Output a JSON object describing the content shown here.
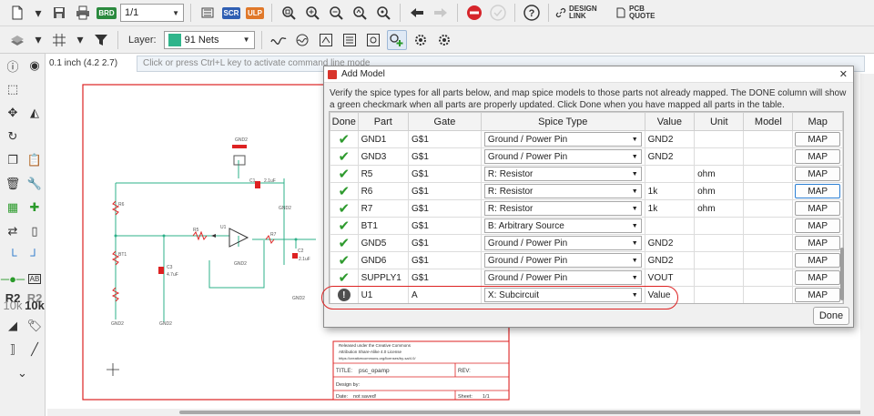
{
  "toolbar1": {
    "page_select": "1/1",
    "scr_label": "SCR",
    "ulp_label": "ULP",
    "design_link_label": "DESIGN LINK",
    "pcb_quote_label": "PCB QUOTE",
    "brd_label": "BRD"
  },
  "toolbar2": {
    "layer_label": "Layer:",
    "layer_value": "91 Nets",
    "layer_color": "#2fb58b"
  },
  "status": {
    "coordinate": "0.1 inch (4.2 2.7)",
    "command_placeholder": "Click or press Ctrl+L key to activate command line mode"
  },
  "left_toolbar": {
    "r2_label": "R2",
    "r2_sub": "10k",
    "r2b_label": "R2",
    "r2b_sub": "10k",
    "ab_label": "AB"
  },
  "dialog": {
    "title": "Add Model",
    "instructions": "Verify the spice types for all parts below, and map spice models to those parts not already mapped.  The DONE column will show a green checkmark when all parts are properly updated.  Click Done when you have mapped all parts in the table.",
    "columns": [
      "Done",
      "Part",
      "Gate",
      "Spice Type",
      "Value",
      "Unit",
      "Model",
      "Map"
    ],
    "rows": [
      {
        "done": "check",
        "part": "GND1",
        "gate": "G$1",
        "spice": "Ground / Power Pin",
        "value": "GND2",
        "unit": "",
        "model": "",
        "map": "MAP"
      },
      {
        "done": "check",
        "part": "GND3",
        "gate": "G$1",
        "spice": "Ground / Power Pin",
        "value": "GND2",
        "unit": "",
        "model": "",
        "map": "MAP"
      },
      {
        "done": "check",
        "part": "R5",
        "gate": "G$1",
        "spice": "R: Resistor",
        "value": "",
        "unit": "ohm",
        "model": "",
        "map": "MAP"
      },
      {
        "done": "check",
        "part": "R6",
        "gate": "G$1",
        "spice": "R: Resistor",
        "value": "1k",
        "unit": "ohm",
        "model": "",
        "map": "MAP"
      },
      {
        "done": "check",
        "part": "R7",
        "gate": "G$1",
        "spice": "R: Resistor",
        "value": "1k",
        "unit": "ohm",
        "model": "",
        "map": "MAP"
      },
      {
        "done": "check",
        "part": "BT1",
        "gate": "G$1",
        "spice": "B: Arbitrary Source",
        "value": "",
        "unit": "",
        "model": "",
        "map": "MAP"
      },
      {
        "done": "check",
        "part": "GND5",
        "gate": "G$1",
        "spice": "Ground / Power Pin",
        "value": "GND2",
        "unit": "",
        "model": "",
        "map": "MAP"
      },
      {
        "done": "check",
        "part": "GND6",
        "gate": "G$1",
        "spice": "Ground / Power Pin",
        "value": "GND2",
        "unit": "",
        "model": "",
        "map": "MAP"
      },
      {
        "done": "check",
        "part": "SUPPLY1",
        "gate": "G$1",
        "spice": "Ground / Power Pin",
        "value": "VOUT",
        "unit": "",
        "model": "",
        "map": "MAP"
      },
      {
        "done": "warn",
        "part": "U1",
        "gate": "A",
        "spice": "X: Subcircuit",
        "value": "Value",
        "unit": "",
        "model": "",
        "map": "MAP"
      }
    ],
    "warn_glyph": "!",
    "done_button": "Done",
    "close_glyph": "✕"
  },
  "title_block": {
    "license_line1": "Released under the Creative Commons",
    "license_line2": "Attribution Share-Alike 4.0 License",
    "license_line3": "https://creativecommons.org/licenses/by-sa/4.0/",
    "title_label": "TITLE:",
    "title_value": "psc_opamp",
    "design_by": "Design by:",
    "rev": "REV:",
    "date_label": "Date:",
    "date_value": "not saved!",
    "sheet_label": "Sheet:",
    "sheet_value": "1/1"
  },
  "schematic_labels": {
    "c1": "C1",
    "c1_val": "2.1uF",
    "c2": "C2",
    "c2_val": "2.1uF",
    "c3": "C3",
    "c3_val": "4.7uF",
    "gnd": "GND2",
    "u1": "U1",
    "r5": "R5",
    "r6": "R6",
    "r7": "R7",
    "bt1": "BT1"
  }
}
